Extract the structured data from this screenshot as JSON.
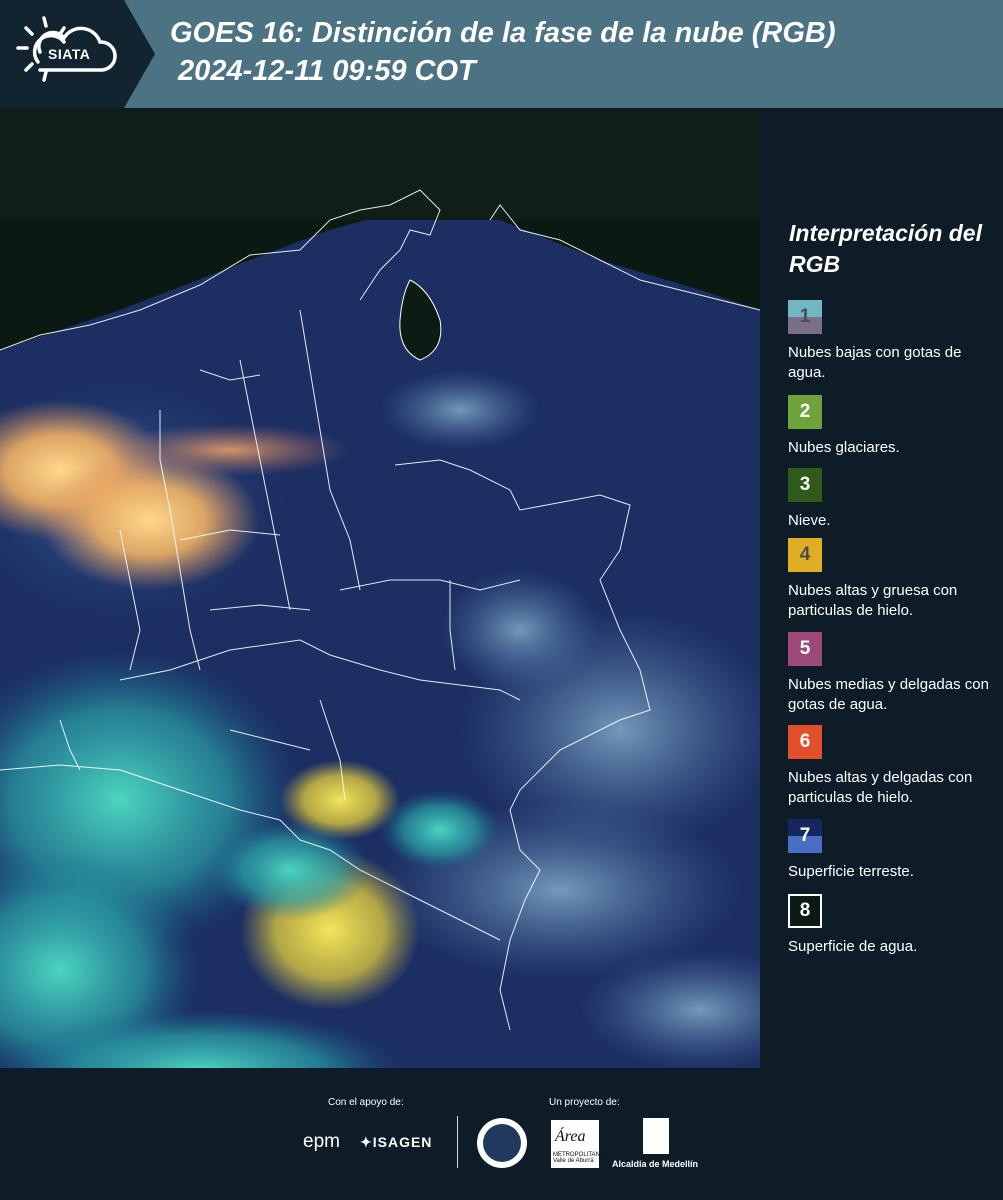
{
  "header": {
    "logo_text": "SIATA",
    "title_line1": "GOES 16: Distinción de la fase de la nube (RGB)",
    "title_line2": " 2024-12-11 09:59 COT",
    "background": "#4b7383"
  },
  "map": {
    "description_icon": "satellite-rgb-map",
    "ocean_color": "#0a1a12",
    "land_color": "#1c2f63",
    "border_color": "#ffffff"
  },
  "legend": {
    "title": "Interpretación del RGB",
    "items": [
      {
        "number": "1",
        "label": "Nubes bajas con gotas de agua.",
        "color_top": "#6fb7c3",
        "color_bottom": "#7b6e8b",
        "split": true
      },
      {
        "number": "2",
        "label": "Nubes glaciares.",
        "color": "#6ea23a",
        "split": false
      },
      {
        "number": "3",
        "label": "Nieve.",
        "color": "#2e5a1b",
        "split": false
      },
      {
        "number": "4",
        "label": "Nubes altas y gruesa con particulas de hielo.",
        "color": "#e0ad23",
        "split": false
      },
      {
        "number": "5",
        "label": "Nubes medias y delgadas con gotas de agua.",
        "color": "#9e4a78",
        "split": false
      },
      {
        "number": "6",
        "label": "Nubes altas y delgadas con particulas de hielo.",
        "color": "#e34f2a",
        "split": false
      },
      {
        "number": "7",
        "label": "Superficie terreste.",
        "color_top": "#14275f",
        "color_bottom": "#4a6ec4",
        "split": true
      },
      {
        "number": "8",
        "label": "Superficie de agua.",
        "color": "#0b1a12",
        "split": false
      }
    ]
  },
  "footer": {
    "support_label": "Con el apoyo de:",
    "project_label": "Un proyecto de:",
    "epm": "epm",
    "isagen": "ISAGEN",
    "area_logo_text": "Área",
    "area_subtext": "METROPOLITANA Valle de Aburrá",
    "alcaldia": "Alcaldía de Medellín"
  }
}
